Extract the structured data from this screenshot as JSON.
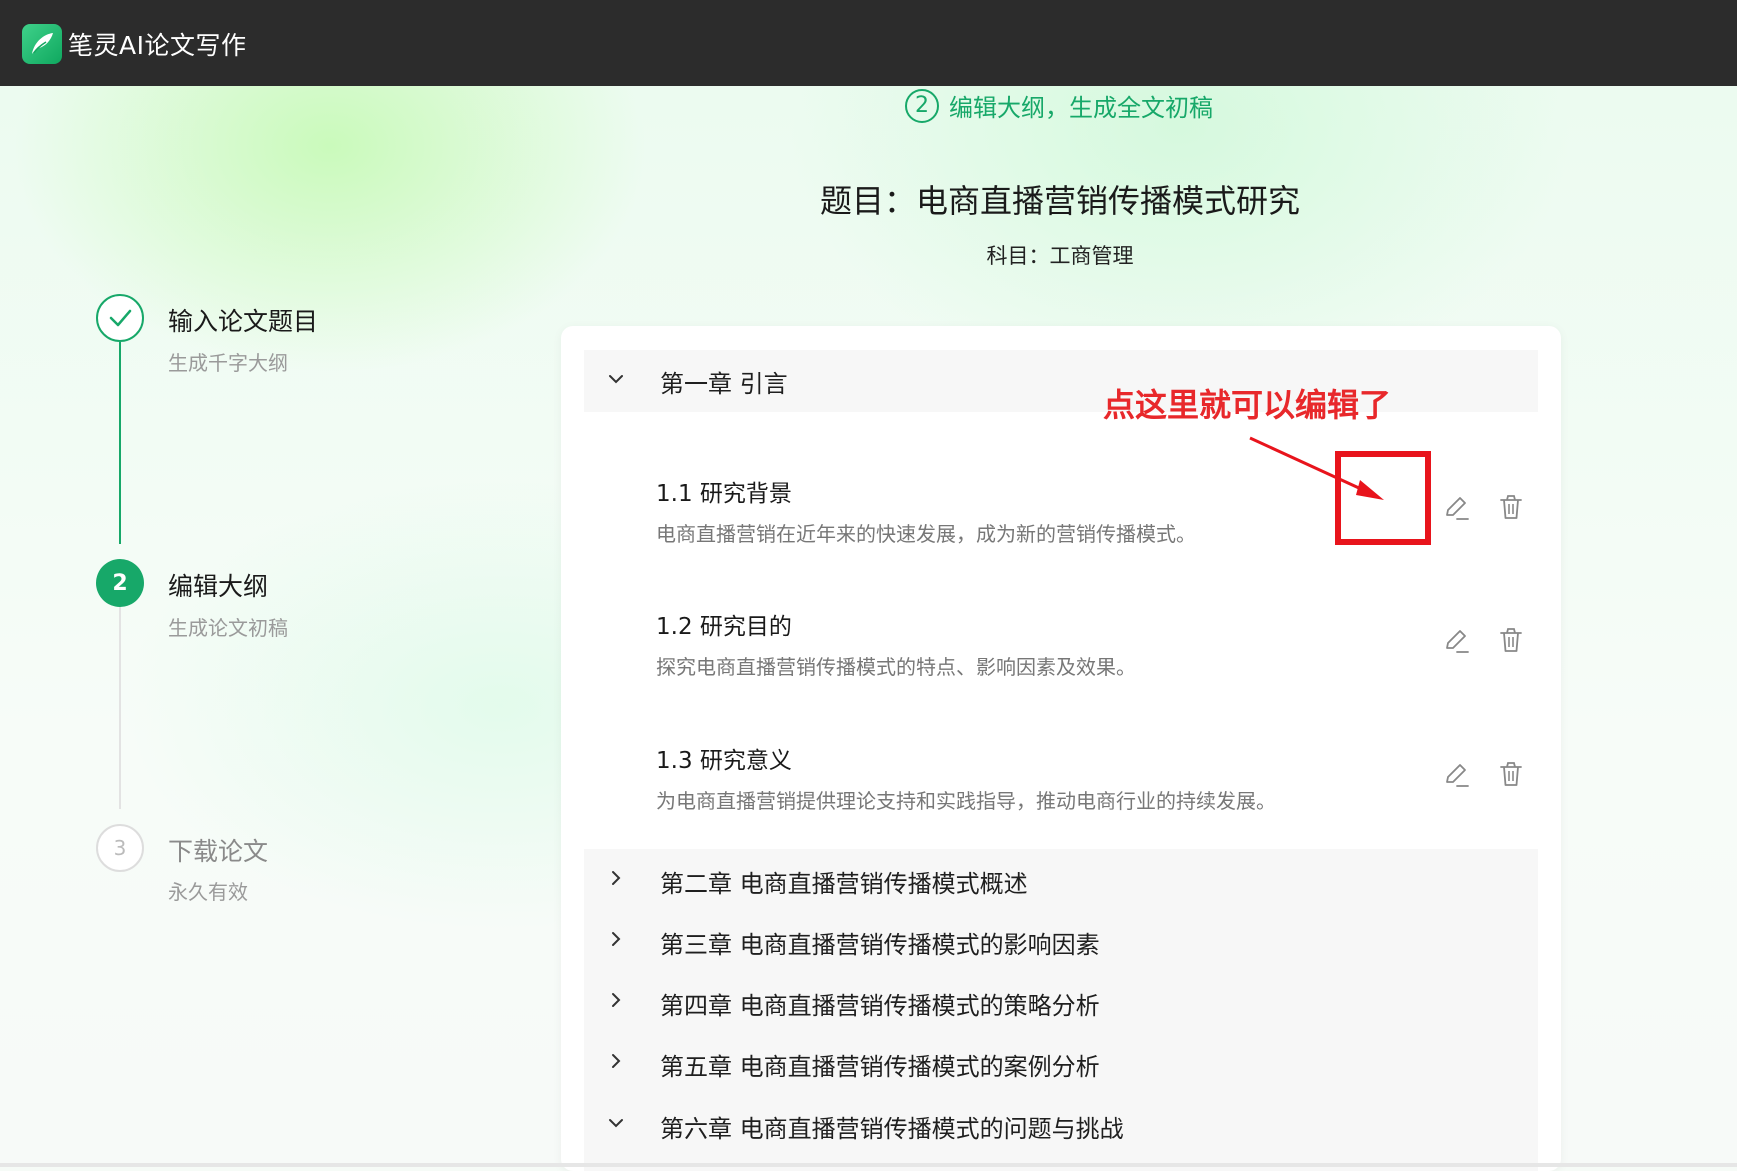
{
  "app": {
    "title": "笔灵AI论文写作",
    "logo_icon": "feather-leaf-icon"
  },
  "step_header": {
    "number": "2",
    "label": "编辑大纲，生成全文初稿"
  },
  "paper": {
    "title": "题目：电商直播营销传播模式研究",
    "subject": "科目：工商管理"
  },
  "steps": [
    {
      "number": "",
      "title": "输入论文题目",
      "desc": "生成千字大纲",
      "status": "done"
    },
    {
      "number": "2",
      "title": "编辑大纲",
      "desc": "生成论文初稿",
      "status": "active"
    },
    {
      "number": "3",
      "title": "下载论文",
      "desc": "永久有效",
      "status": "pending"
    }
  ],
  "outline": {
    "chapter1": {
      "label": "第一章 引言",
      "expanded": true
    },
    "sections": [
      {
        "title": "1.1 研究背景",
        "desc": "电商直播营销在近年来的快速发展，成为新的营销传播模式。"
      },
      {
        "title": "1.2 研究目的",
        "desc": "探究电商直播营销传播模式的特点、影响因素及效果。"
      },
      {
        "title": "1.3 研究意义",
        "desc": "为电商直播营销提供理论支持和实践指导，推动电商行业的持续发展。"
      }
    ],
    "chapters": [
      {
        "label": "第二章 电商直播营销传播模式概述",
        "expanded": false
      },
      {
        "label": "第三章 电商直播营销传播模式的影响因素",
        "expanded": false
      },
      {
        "label": "第四章 电商直播营销传播模式的策略分析",
        "expanded": false
      },
      {
        "label": "第五章 电商直播营销传播模式的案例分析",
        "expanded": false
      },
      {
        "label": "第六章 电商直播营销传播模式的问题与挑战",
        "expanded": true
      }
    ]
  },
  "annotation": {
    "text": "点这里就可以编辑了"
  },
  "colors": {
    "accent": "#17a869",
    "annotation_red": "#e8141c",
    "topbar": "#2c2c2c"
  }
}
